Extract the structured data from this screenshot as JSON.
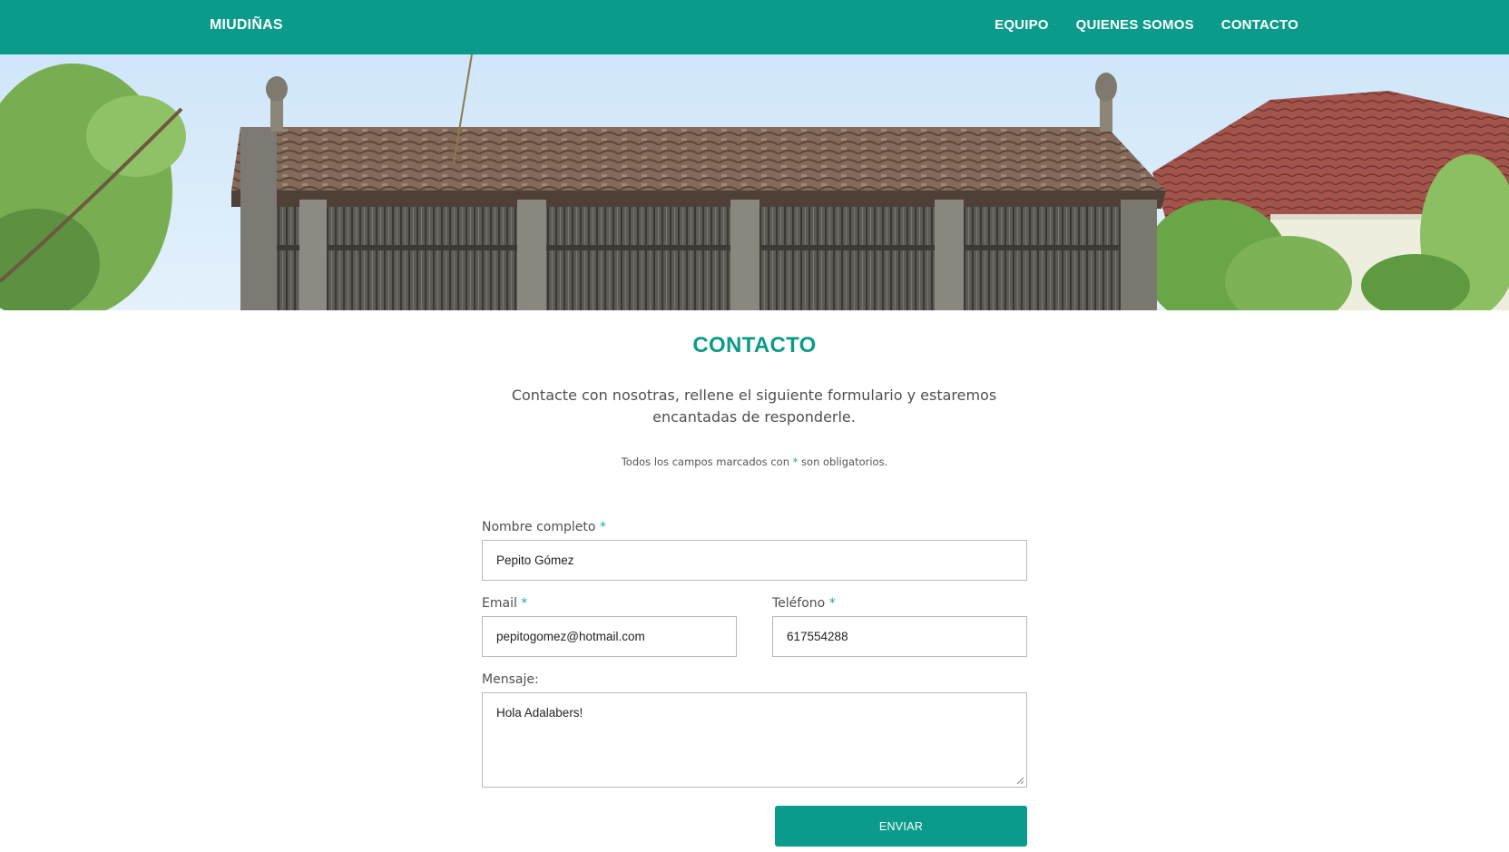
{
  "header": {
    "brand": "MIUDIÑAS",
    "nav": [
      {
        "label": "EQUIPO"
      },
      {
        "label": "QUIENES SOMOS"
      },
      {
        "label": "CONTACTO"
      }
    ],
    "background_color": "#0b9b8a"
  },
  "hero": {
    "image": "hórreo-with-tiled-roof-photo"
  },
  "main": {
    "title": "CONTACTO",
    "intro": "Contacte con nosotras, rellene el siguiente formulario y estaremos encantadas de responderle.",
    "required_note": {
      "before": "Todos los campos marcados con ",
      "star": "*",
      "after": " son obligatorios."
    }
  },
  "form": {
    "name": {
      "label": "Nombre completo",
      "star": "*",
      "value": "Pepito Gómez"
    },
    "email": {
      "label": "Email",
      "star": "*",
      "value": "pepitogomez@hotmail.com"
    },
    "phone": {
      "label": "Teléfono",
      "star": "*",
      "value": "617554288"
    },
    "message": {
      "label": "Mensaje:",
      "value": "Hola Adalabers!"
    },
    "submit_label": "ENVIAR"
  },
  "colors": {
    "accent": "#0b9b8a",
    "required_star": "#1aa99a"
  }
}
